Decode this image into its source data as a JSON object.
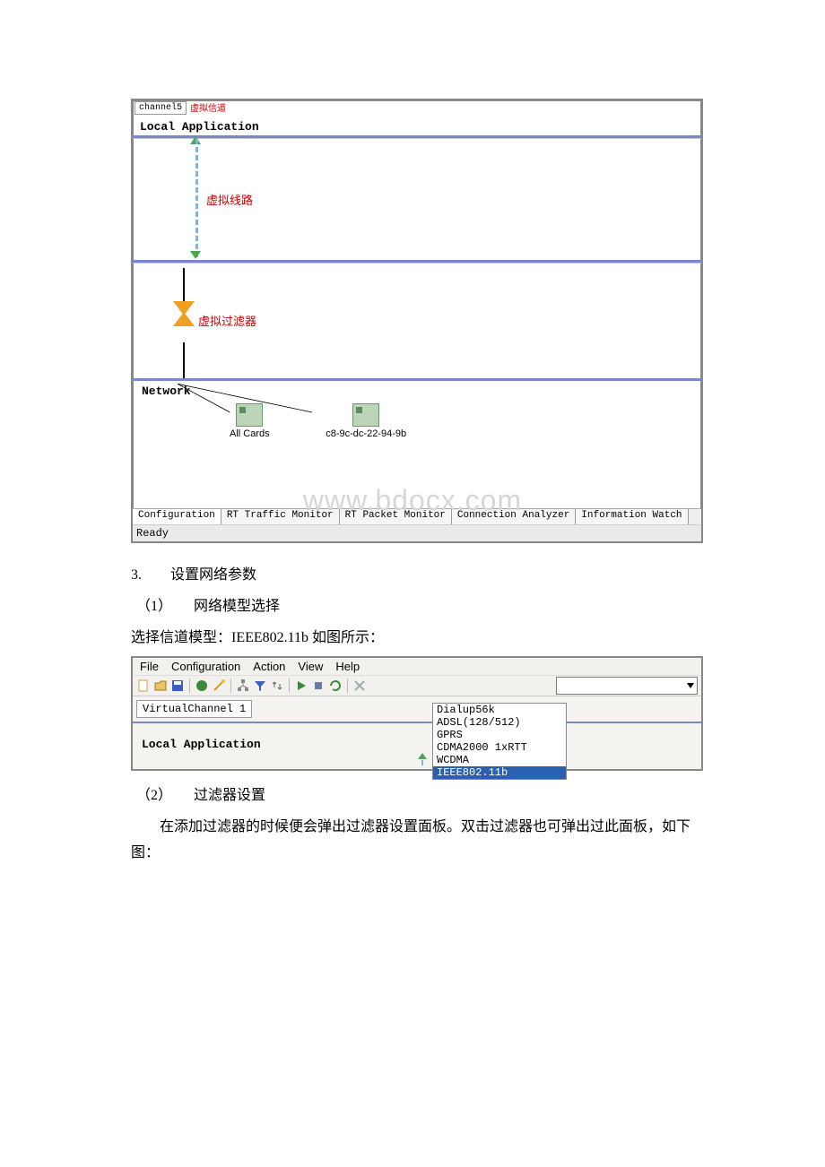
{
  "screenshot1": {
    "top_tab": "channel5",
    "top_tab_annot": "虚拟信道",
    "local_app": "Local Application",
    "link_label": "虚拟线路",
    "filter_label": "虚拟过滤器",
    "network": "Network",
    "nic1": "All Cards",
    "nic2": "c8-9c-dc-22-94-9b",
    "tabs": [
      "Configuration",
      "RT Traffic Monitor",
      "RT Packet Monitor",
      "Connection Analyzer",
      "Information Watch"
    ],
    "status": "Ready"
  },
  "watermark": "www.bdocx.com",
  "text": {
    "item3": "3.　　设置网络参数",
    "sub1": "（1）　　网络模型选择",
    "line1": "选择信道模型：IEEE802.11b 如图所示：",
    "sub2": "（2）　　过滤器设置",
    "line2": "　　在添加过滤器的时候便会弹出过滤器设置面板。双击过滤器也可弹出过此面板，如下图："
  },
  "screenshot2": {
    "menus": [
      "File",
      "Configuration",
      "Action",
      "View",
      "Help"
    ],
    "vc_tab": "VirtualChannel 1",
    "local_app": "Local Application",
    "options": [
      "Dialup56k",
      "ADSL(128/512)",
      "GPRS",
      "CDMA2000 1xRTT",
      "WCDMA",
      "IEEE802.11b"
    ],
    "selected": "IEEE802.11b"
  }
}
